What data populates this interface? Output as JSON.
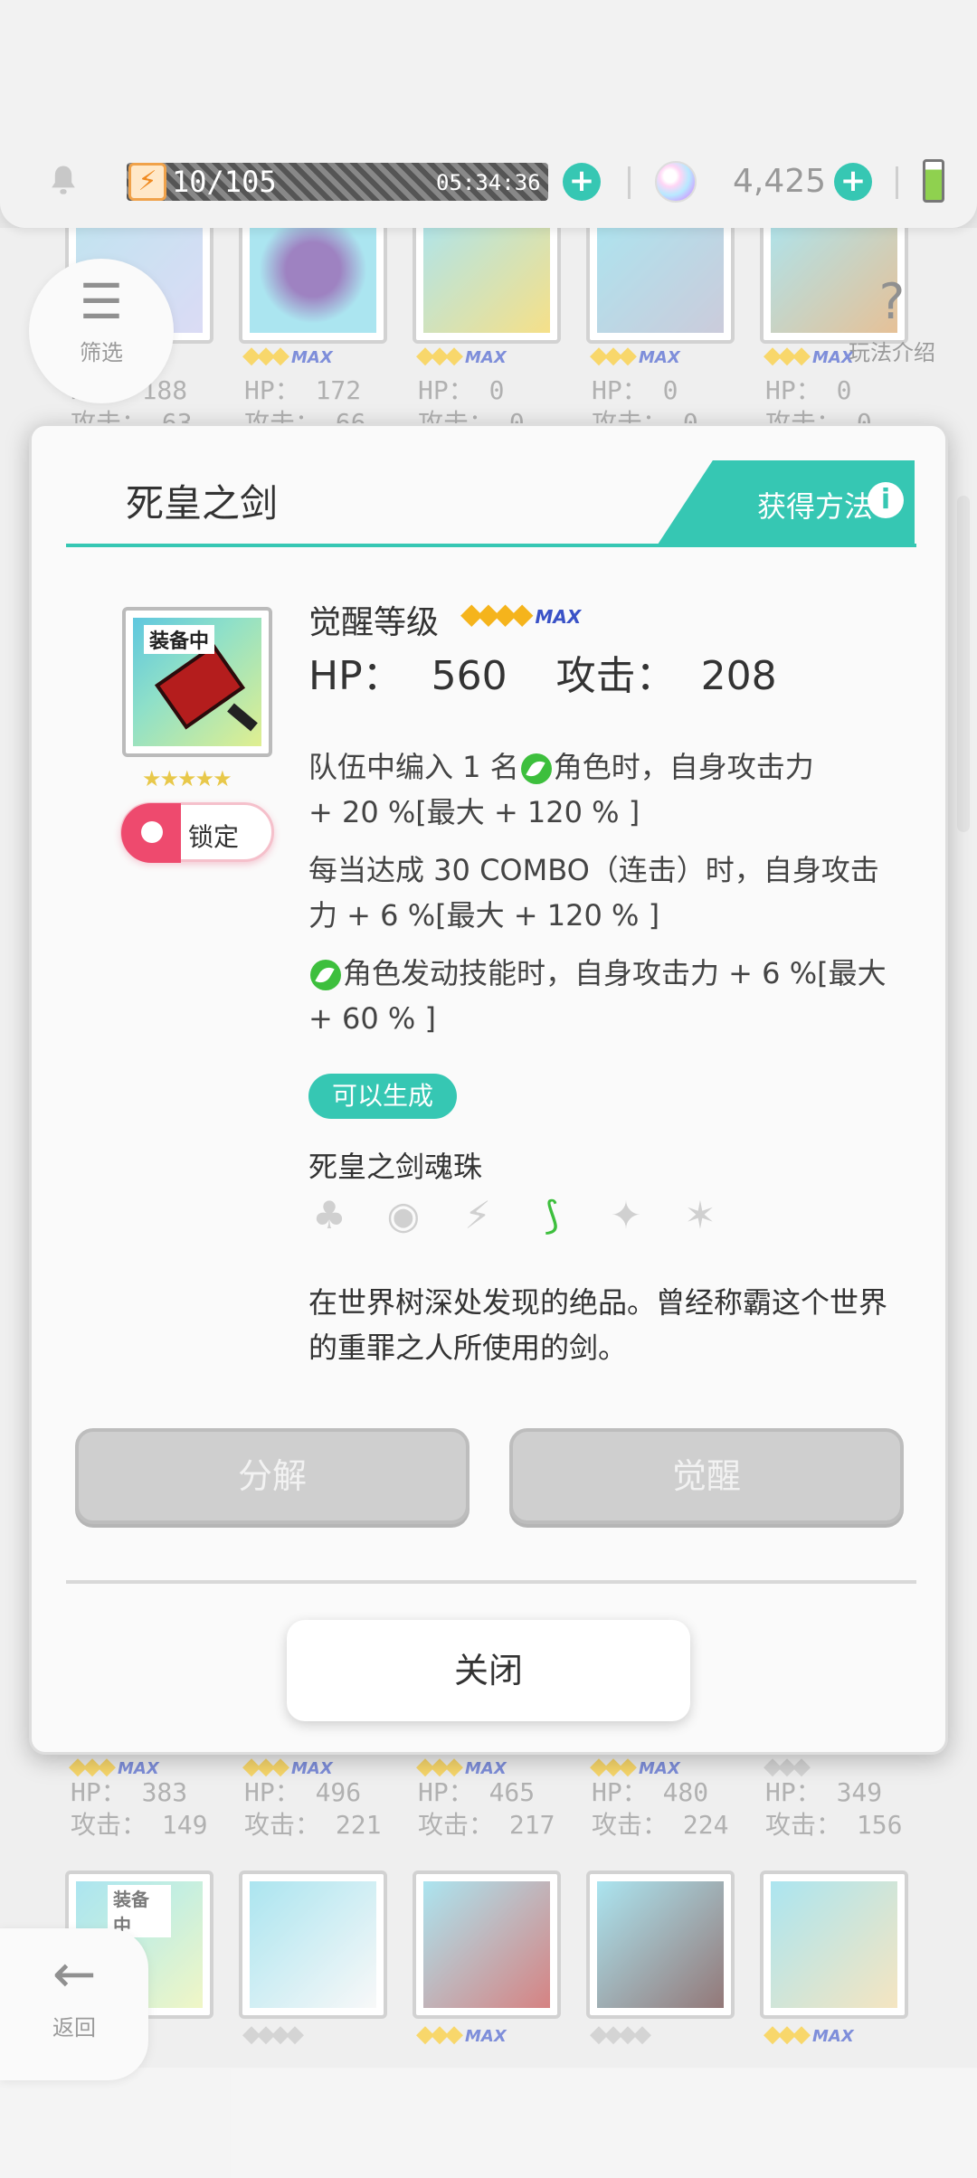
{
  "status_bar": {
    "stamina_text": "10/105",
    "stamina_timer": "05:34:36",
    "gem_count": "4,425"
  },
  "nav": {
    "filter_label": "筛选",
    "help_label": "玩法介绍",
    "back_label": "返回"
  },
  "grid": {
    "top_row": [
      {
        "hp": "HP： 188",
        "atk": "攻击： 63"
      },
      {
        "hp": "HP： 172",
        "atk": "攻击： 66"
      },
      {
        "hp": "HP： 0",
        "atk": "攻击： 0"
      },
      {
        "hp": "HP： 0",
        "atk": "攻击： 0"
      },
      {
        "hp": "HP： 0",
        "atk": "攻击： 0"
      }
    ],
    "middle_row": [
      {
        "hp": "HP： 383",
        "atk": "攻击： 149"
      },
      {
        "hp": "HP： 496",
        "atk": "攻击： 221"
      },
      {
        "hp": "HP： 465",
        "atk": "攻击： 217"
      },
      {
        "hp": "HP： 480",
        "atk": "攻击： 224"
      },
      {
        "hp": "HP： 349",
        "atk": "攻击： 156"
      }
    ],
    "equipped_tag": "装备中",
    "max_label": "MAX"
  },
  "modal": {
    "title": "死皇之剑",
    "get_method": "获得方法",
    "info_glyph": "i",
    "equipped_tag": "装备中",
    "lock_label": "锁定",
    "awaken_label": "觉醒等级",
    "max_label": "MAX",
    "hp_label": "HP：",
    "hp_value": "560",
    "atk_label": "攻击：",
    "atk_value": "208",
    "effects": {
      "e1_a": "队伍中编入 1 名",
      "e1_b": "角色时，自身攻击力",
      "e1_c": "+ 20 %[最大 + 120 % ]",
      "e2": "每当达成 30 COMBO（连击）时，自身攻击力 + 6 %[最大 + 120 % ]",
      "e3": "角色发动技能时，自身攻击力 + 6 %[最大 + 60 % ]"
    },
    "craft_badge": "可以生成",
    "orb_name": "死皇之剑魂珠",
    "description": "在世界树深处发现的绝品。曾经称霸这个世界的重罪之人所使用的剑。",
    "decompose_label": "分解",
    "awaken_button_label": "觉醒",
    "close_label": "关闭"
  },
  "colors": {
    "accent": "#36c7b3",
    "lock": "#ee4a6e",
    "star": "#f5b41c",
    "leaf_attribute": "#3dbf3d"
  }
}
